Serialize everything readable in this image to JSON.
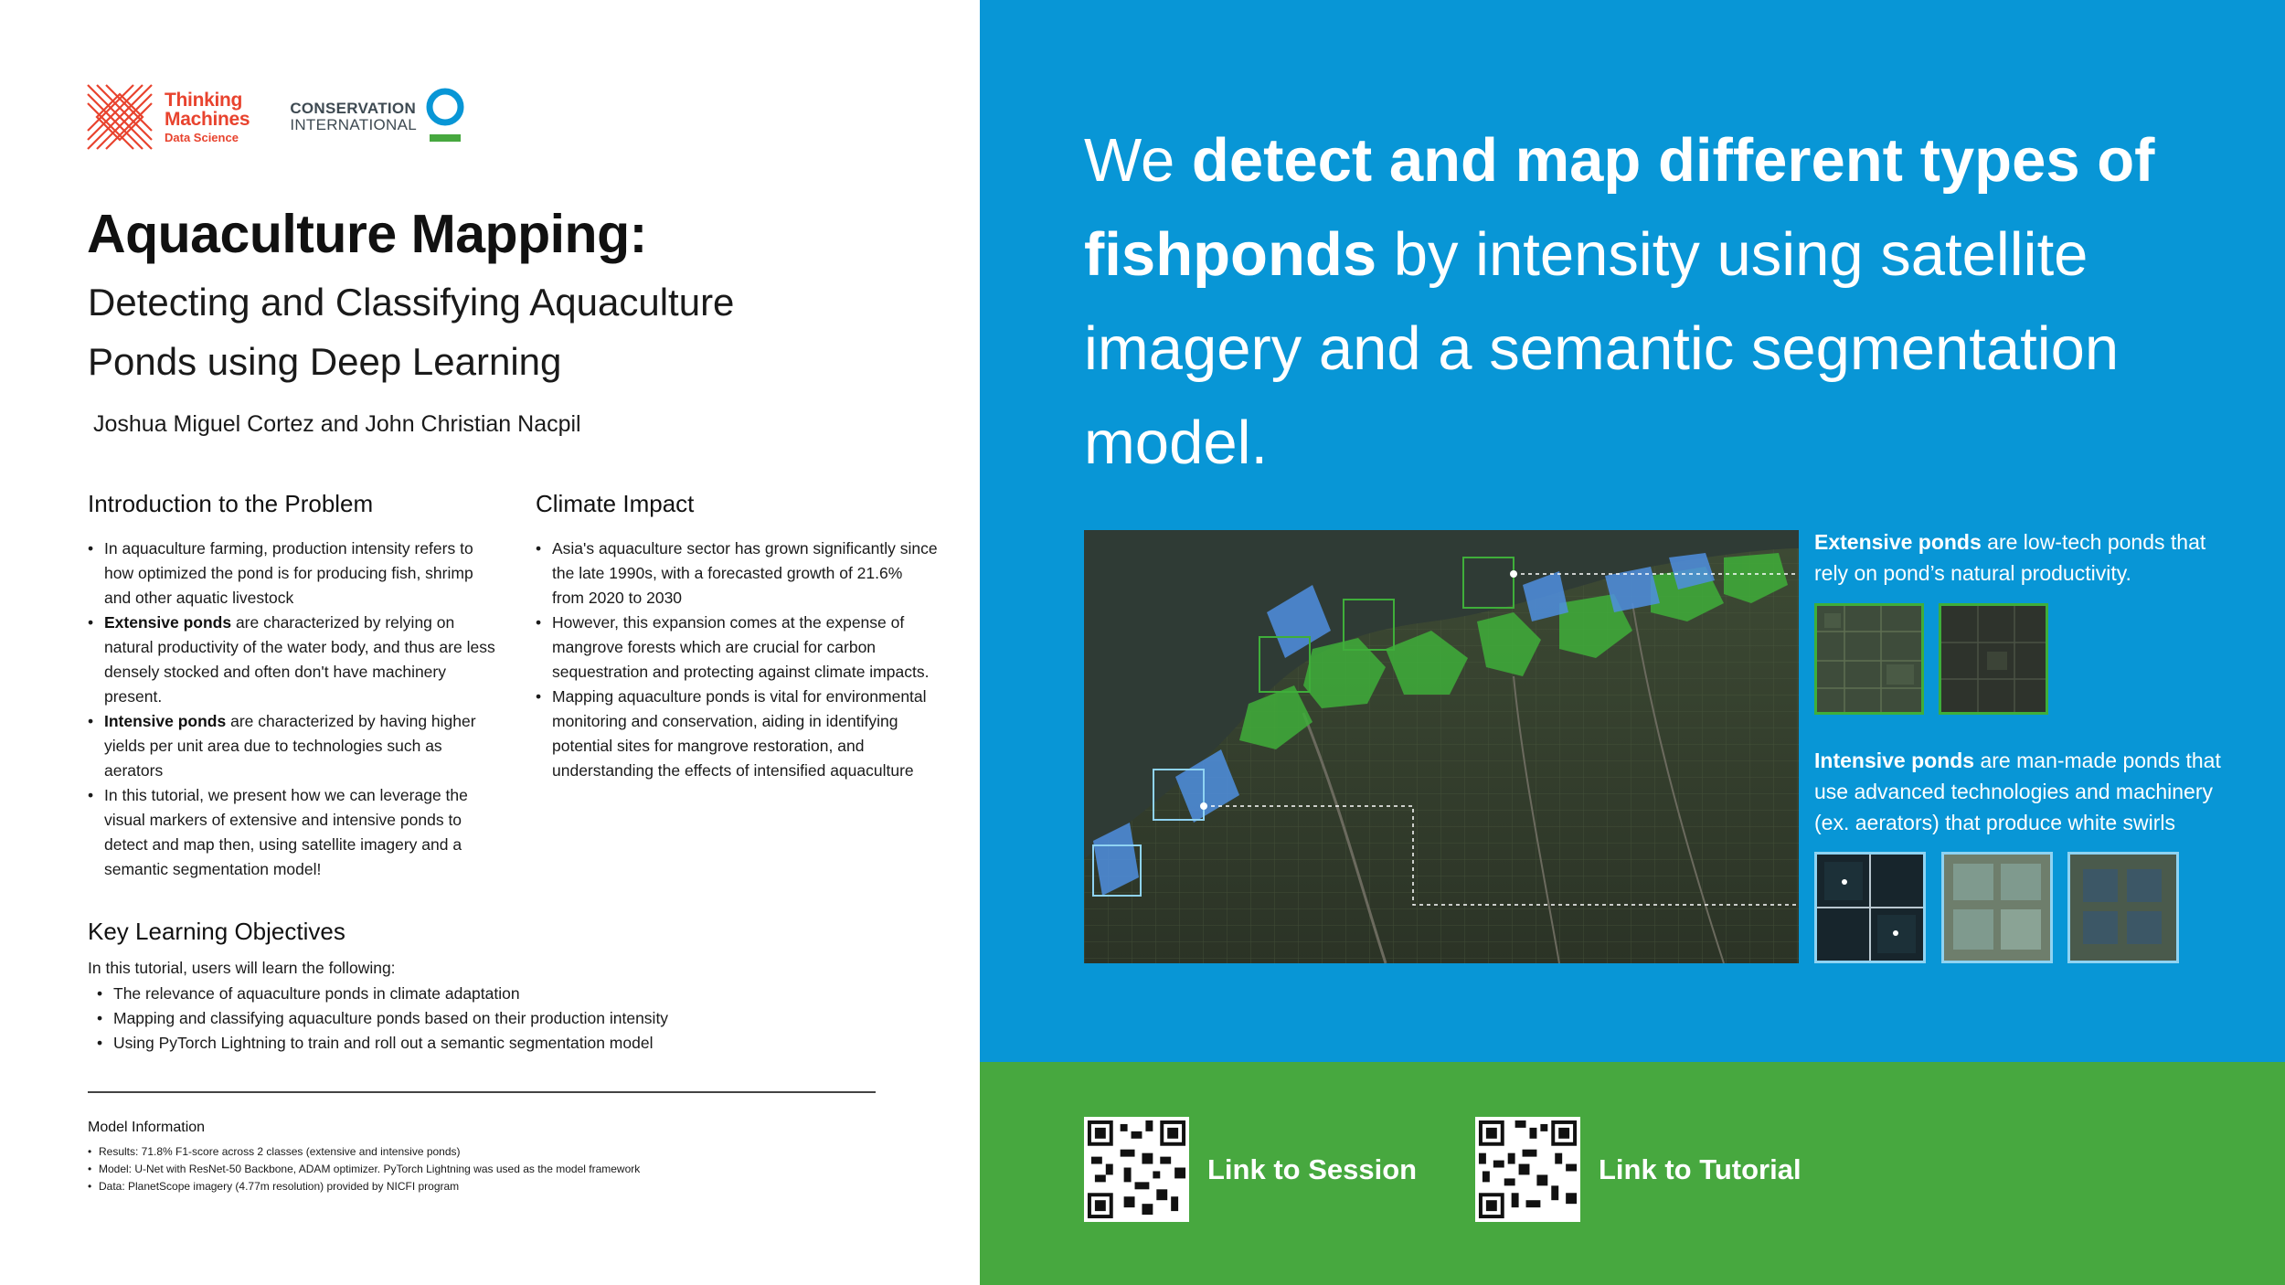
{
  "logos": {
    "thinking_machines": {
      "line1": "Thinking",
      "line2": "Machines",
      "line3": "Data Science",
      "color": "#e8432e"
    },
    "conservation_international": {
      "line1": "CONSERVATION",
      "line2": "INTERNATIONAL",
      "ring_color": "#0896d6",
      "bar_color": "#47a83f"
    }
  },
  "header": {
    "title": "Aquaculture Mapping:",
    "subtitle": "Detecting and Classifying Aquaculture Ponds using Deep Learning",
    "authors": "Joshua Miguel Cortez and John Christian Nacpil"
  },
  "intro": {
    "heading": "Introduction to the Problem",
    "items": [
      {
        "bold": "",
        "text": "In aquaculture farming, production intensity refers to how optimized the pond is for producing fish, shrimp and other aquatic livestock"
      },
      {
        "bold": "Extensive ponds",
        "text": " are characterized by relying on natural productivity of the water body, and thus are less densely stocked and often don't have machinery present."
      },
      {
        "bold": "Intensive ponds",
        "text": " are characterized by having higher yields per unit area due to technologies such as aerators"
      },
      {
        "bold": "",
        "text": "In this tutorial, we present how we can leverage the visual markers of extensive and intensive ponds to detect and map then, using satellite imagery and a semantic segmentation model!"
      }
    ]
  },
  "climate": {
    "heading": "Climate Impact",
    "items": [
      "Asia's aquaculture sector has grown significantly since the late 1990s, with a forecasted growth of 21.6% from 2020 to 2030",
      "However, this expansion comes at the expense of mangrove forests which are crucial for carbon sequestration and protecting against climate impacts.",
      "Mapping aquaculture ponds is vital for environmental monitoring and conservation, aiding in identifying potential sites for mangrove restoration, and understanding the effects of intensified aquaculture"
    ]
  },
  "objectives": {
    "heading": "Key Learning Objectives",
    "intro": "In this tutorial, users will learn the following:",
    "items": [
      "The relevance of aquaculture ponds in climate adaptation",
      "Mapping and classifying aquaculture ponds based on their production intensity",
      "Using PyTorch Lightning to train and roll out a semantic segmentation model"
    ]
  },
  "model_info": {
    "heading": "Model Information",
    "items": [
      "Results: 71.8% F1-score across 2 classes (extensive and intensive ponds)",
      "Model: U-Net with ResNet-50 Backbone, ADAM optimizer. PyTorch Lightning was used as the model framework",
      "Data: PlanetScope imagery (4.77m resolution) provided by NICFI program"
    ]
  },
  "hero": {
    "p1": "We ",
    "b1": "detect and map different types of fishponds",
    "p2": " by intensity using satellite imagery and a semantic segmentation model."
  },
  "legend": {
    "extensive_bold": "Extensive ponds",
    "extensive_text": " are low-tech ponds that rely on pond’s natural productivity.",
    "intensive_bold": "Intensive ponds",
    "intensive_text": " are man-made ponds that use advanced technologies and machinery (ex. aerators) that produce white swirls",
    "extensive_color": "#3fae3a",
    "intensive_color": "#8fd3f2"
  },
  "links": {
    "session": "Link to Session",
    "tutorial": "Link to Tutorial"
  },
  "colors": {
    "blue_panel": "#0896d6",
    "green_panel": "#47a83f"
  }
}
